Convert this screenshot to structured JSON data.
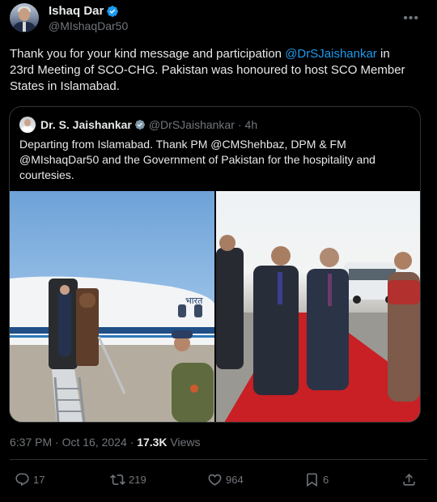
{
  "author": {
    "display_name": "Ishaq Dar",
    "handle": "@MIshaqDar50"
  },
  "more_icon": "more-horizontal-icon",
  "tweet": {
    "text_before": "Thank you for your kind message and participation ",
    "mention": "@DrSJaishankar",
    "text_after": " in 23rd Meeting of SCO-CHG. Pakistan was honoured to host SCO Member States in Islamabad."
  },
  "quoted": {
    "display_name": "Dr. S. Jaishankar",
    "handle": "@DrSJaishankar",
    "separator": "·",
    "time": "4h",
    "text": "Departing from Islamabad. Thank PM @CMShehbaz, DPM & FM @MIshaqDar50 and the Government of Pakistan for the hospitality and courtesies.",
    "aircraft_lettering": "भारत"
  },
  "meta": {
    "timestamp": "6:37 PM · Oct 16, 2024 · ",
    "views_count": "17.3K",
    "views_label": " Views"
  },
  "actions": {
    "replies": "17",
    "reposts": "219",
    "likes": "964",
    "bookmarks": "6"
  },
  "colors": {
    "background": "#000000",
    "text": "#e7e9ea",
    "secondary": "#71767b",
    "accent": "#1d9bf0",
    "border": "#2f3336"
  }
}
